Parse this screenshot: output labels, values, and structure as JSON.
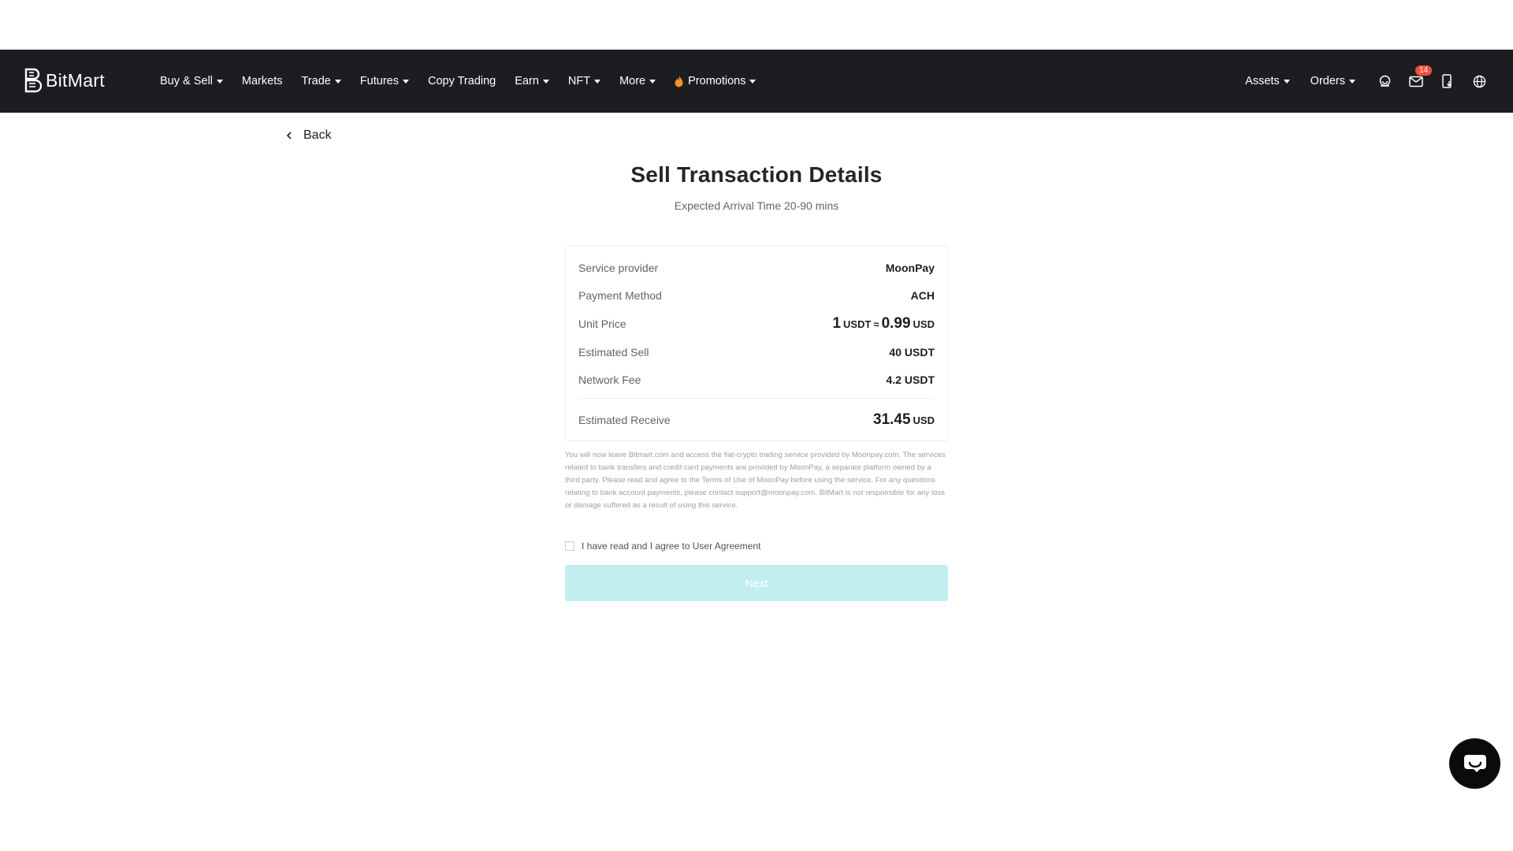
{
  "header": {
    "brand": "BitMart",
    "nav": [
      {
        "label": "Buy & Sell",
        "dropdown": true
      },
      {
        "label": "Markets",
        "dropdown": false
      },
      {
        "label": "Trade",
        "dropdown": true
      },
      {
        "label": "Futures",
        "dropdown": true
      },
      {
        "label": "Copy Trading",
        "dropdown": false
      },
      {
        "label": "Earn",
        "dropdown": true
      },
      {
        "label": "NFT",
        "dropdown": true
      },
      {
        "label": "More",
        "dropdown": true
      },
      {
        "label": "Promotions",
        "dropdown": true,
        "icon": "flame-icon"
      }
    ],
    "right": {
      "assets_label": "Assets",
      "orders_label": "Orders",
      "messages_badge": "14",
      "icons": [
        "support-icon",
        "mail-icon",
        "mobile-download-icon",
        "globe-icon"
      ]
    }
  },
  "back_label": "Back",
  "title": "Sell Transaction Details",
  "subtitle": "Expected Arrival Time 20-90 mins",
  "details": {
    "service_provider": {
      "label": "Service provider",
      "value": "MoonPay"
    },
    "payment_method": {
      "label": "Payment Method",
      "value": "ACH"
    },
    "unit_price": {
      "label": "Unit Price",
      "amount_left": "1",
      "unit_left": "USDT",
      "approx": "≈",
      "amount_right": "0.99",
      "unit_right": "USD"
    },
    "estimated_sell": {
      "label": "Estimated Sell",
      "value": "40 USDT"
    },
    "network_fee": {
      "label": "Network Fee",
      "value": "4.2 USDT"
    },
    "estimated_receive": {
      "label": "Estimated Receive",
      "amount": "31.45",
      "unit": "USD"
    }
  },
  "disclaimer": "You will now leave Bitmart.com and access the fiat-crypto trading service provided by Moonpay.com. The services related to bank transfers and credit card payments are provided by MoonPay, a separate platform owned by a third party. Please read and agree to the Terms of Use of MoonPay before using the service. For any questions relating to bank account payments, please contact support@moonpay.com. BitMart is not responsible for any loss or damage suffered as a result of using this service.",
  "agreement": {
    "label": "I have read and I agree to User Agreement",
    "checked": false
  },
  "next_label": "Next",
  "colors": {
    "header_bg": "#1c1d20",
    "next_disabled": "#c2eef0",
    "badge": "#ef4f3e"
  }
}
